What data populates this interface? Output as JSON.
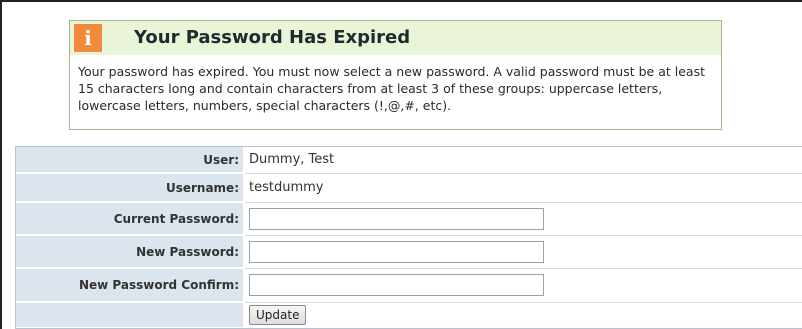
{
  "notice": {
    "icon": "info-icon",
    "icon_glyph": "i",
    "title": "Your Password Has Expired",
    "body": "Your password has expired. You must now select a new password. A valid password must be at least 15 characters long and contain characters from at least 3 of these groups: uppercase letters, lowercase letters, numbers, special characters (!,@,#, etc).",
    "colors": {
      "header_bg": "#eaf4d6",
      "icon_bg": "#f08a3c",
      "border": "#a7b48e"
    }
  },
  "form": {
    "label_bg": "#dce4ee",
    "rows": [
      {
        "label": "User:",
        "value": "Dummy, Test"
      },
      {
        "label": "Username:",
        "value": "testdummy"
      },
      {
        "label": "Current Password:",
        "value": ""
      },
      {
        "label": "New Password:",
        "value": ""
      },
      {
        "label": "New Password Confirm:",
        "value": ""
      }
    ],
    "submit_label": "Update"
  }
}
